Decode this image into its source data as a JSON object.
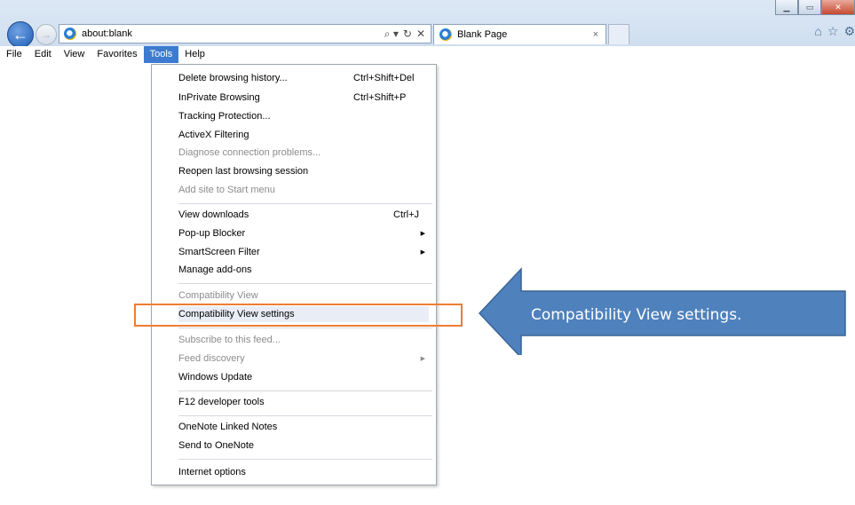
{
  "browser": {
    "address": "about:blank",
    "tab_title": "Blank Page",
    "address_controls": [
      "⌕ ▾",
      "↻",
      "✕"
    ],
    "tab_close": "×",
    "window_buttons": {
      "minimize": "▁",
      "maximize": "▭",
      "close": "✕"
    },
    "toolbar_icons": [
      "home-icon",
      "star-icon",
      "gear-icon"
    ]
  },
  "menubar": {
    "items": [
      "File",
      "Edit",
      "View",
      "Favorites",
      "Tools",
      "Help"
    ],
    "active": "Tools"
  },
  "tools_menu": {
    "items": [
      {
        "label": "Delete browsing history...",
        "shortcut": "Ctrl+Shift+Del"
      },
      {
        "label": "InPrivate Browsing",
        "shortcut": "Ctrl+Shift+P"
      },
      {
        "label": "Tracking Protection..."
      },
      {
        "label": "ActiveX Filtering"
      },
      {
        "label": "Diagnose connection problems...",
        "disabled": true
      },
      {
        "label": "Reopen last browsing session"
      },
      {
        "label": "Add site to Start menu",
        "disabled": true
      },
      {
        "label": "View downloads",
        "shortcut": "Ctrl+J"
      },
      {
        "label": "Pop-up Blocker",
        "submenu": true
      },
      {
        "label": "SmartScreen Filter",
        "submenu": true
      },
      {
        "label": "Manage add-ons"
      },
      {
        "label": "Compatibility View",
        "disabled": true
      },
      {
        "label": "Compatibility View settings",
        "highlighted": true
      },
      {
        "label": "Subscribe to this feed...",
        "disabled": true
      },
      {
        "label": "Feed discovery",
        "disabled": true,
        "submenu": true
      },
      {
        "label": "Windows Update"
      },
      {
        "label": "F12 developer tools"
      },
      {
        "label": "OneNote Linked Notes"
      },
      {
        "label": "Send to OneNote"
      },
      {
        "label": "Internet options"
      }
    ]
  },
  "annotation": {
    "callout_text": "Compatibility View settings.",
    "box_color": "#ee7d31",
    "arrow_fill": "#4f81bd",
    "arrow_stroke": "#3a6496"
  }
}
